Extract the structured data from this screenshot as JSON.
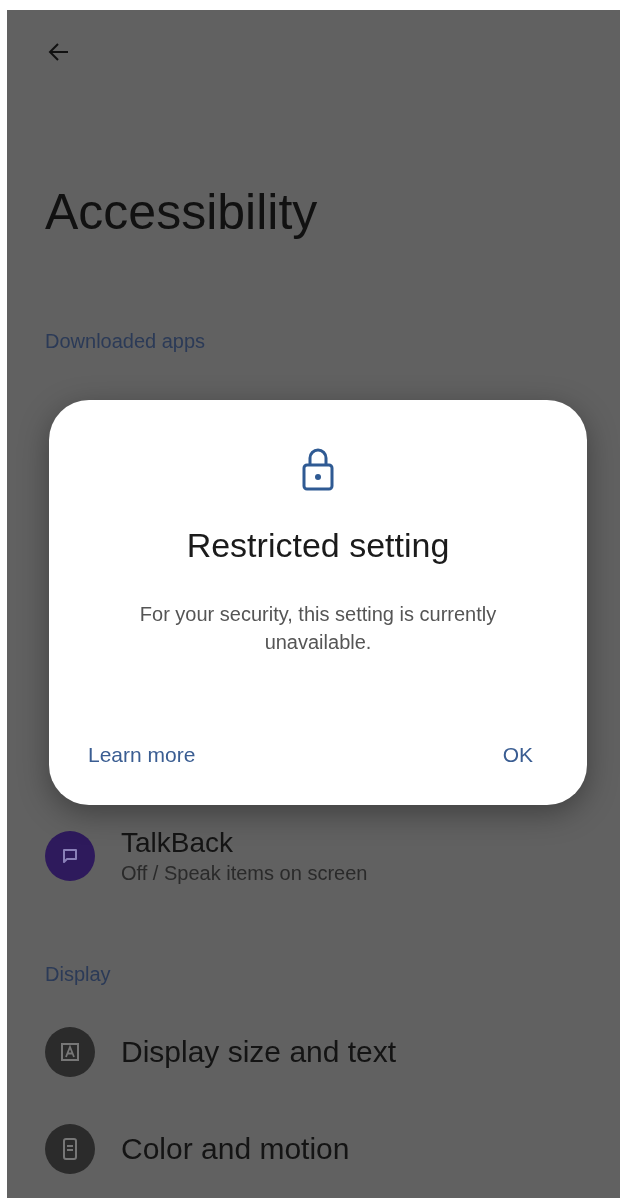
{
  "title": "Accessibility",
  "downloaded_header": "Downloaded apps",
  "list": [
    {
      "kind": "app",
      "title": "TalkBack",
      "subtitle": "Off / Speak items on screen"
    },
    {
      "kind": "header",
      "text": "Display"
    },
    {
      "kind": "item",
      "title": "Display size and text"
    },
    {
      "kind": "item",
      "title": "Color and motion"
    }
  ],
  "dialog": {
    "title": "Restricted setting",
    "message": "For your security, this setting is currently unavailable.",
    "buttons": [
      "Learn more",
      "OK"
    ]
  }
}
